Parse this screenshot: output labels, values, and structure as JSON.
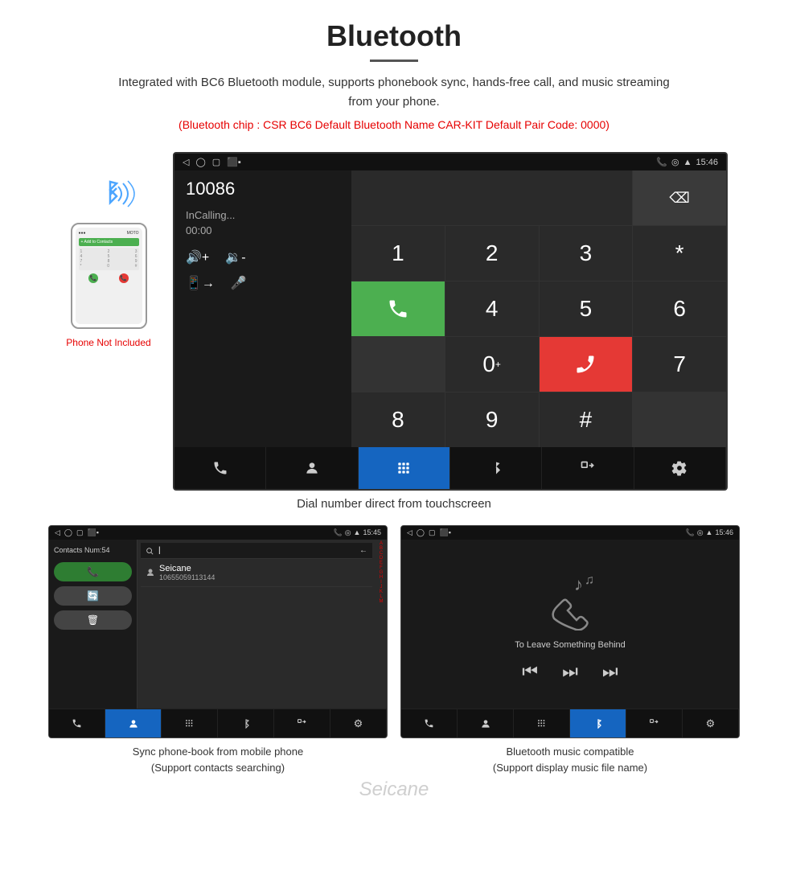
{
  "header": {
    "title": "Bluetooth",
    "description": "Integrated with BC6 Bluetooth module, supports phonebook sync, hands-free call, and music streaming from your phone.",
    "specs": "(Bluetooth chip : CSR BC6    Default Bluetooth Name CAR-KIT    Default Pair Code: 0000)"
  },
  "phone_side": {
    "not_included": "Phone Not Included"
  },
  "car_screen": {
    "status_bar": {
      "left_icons": [
        "back-icon",
        "home-icon",
        "recents-icon",
        "notification-icon"
      ],
      "time": "15:46",
      "right_icons": [
        "phone-icon",
        "location-icon",
        "wifi-icon"
      ]
    },
    "dialed_number": "10086",
    "call_status": "InCalling...",
    "call_timer": "00:00",
    "dialpad_keys": [
      "1",
      "2",
      "3",
      "*",
      "4",
      "5",
      "6",
      "0+",
      "7",
      "8",
      "9",
      "#"
    ],
    "green_btn_label": "call",
    "red_btn_label": "end",
    "backspace_label": "⌫",
    "bottom_bar": {
      "buttons": [
        "phone-transfer",
        "contacts",
        "dialpad",
        "bluetooth",
        "transfer",
        "settings"
      ]
    }
  },
  "main_caption": "Dial number direct from touchscreen",
  "contacts_screen": {
    "status_bar": {
      "time": "15:45",
      "left_icons": [
        "back",
        "home",
        "recents",
        "notification"
      ],
      "right_icons": [
        "phone",
        "location",
        "wifi"
      ]
    },
    "contacts_num_label": "Contacts Num:54",
    "action_buttons": [
      "call",
      "sync",
      "delete"
    ],
    "search_placeholder": "Search",
    "contact_name": "Seicane",
    "contact_number": "10655059113144",
    "alphabet": [
      "A",
      "B",
      "C",
      "D",
      "E",
      "F",
      "G",
      "H",
      "I",
      "J",
      "K",
      "L",
      "M"
    ],
    "bottom_buttons": [
      "phone",
      "contacts",
      "dialpad",
      "bluetooth",
      "transfer",
      "settings"
    ]
  },
  "music_screen": {
    "status_bar": {
      "time": "15:46",
      "left_icons": [
        "back",
        "home",
        "recents",
        "notification"
      ],
      "right_icons": [
        "phone",
        "location",
        "wifi"
      ]
    },
    "song_title": "To Leave Something Behind",
    "controls": [
      "prev",
      "play-pause",
      "next"
    ],
    "bottom_buttons": [
      "phone",
      "contacts",
      "dialpad",
      "bluetooth",
      "transfer",
      "settings"
    ]
  },
  "bottom_captions": {
    "contacts": "Sync phone-book from mobile phone\n(Support contacts searching)",
    "music": "Bluetooth music compatible\n(Support display music file name)"
  },
  "watermark": "Seicane"
}
